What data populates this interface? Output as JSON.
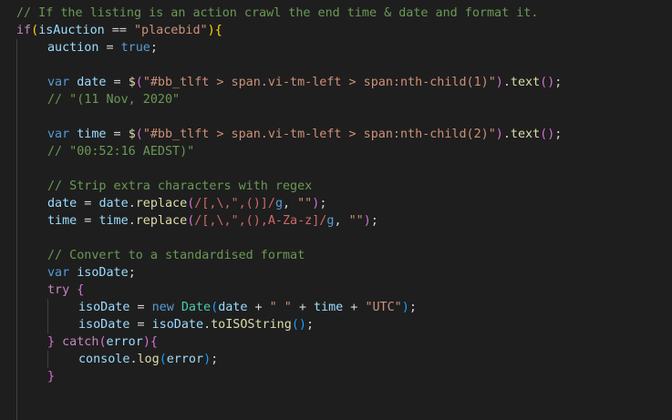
{
  "editor": {
    "lines": [
      {
        "indent": 0,
        "tokens": [
          {
            "t": "// If the listing is an action crawl the end time & date and format it.",
            "c": "c"
          }
        ]
      },
      {
        "indent": 0,
        "tokens": [
          {
            "t": "if",
            "c": "k"
          },
          {
            "t": "(",
            "c": "y"
          },
          {
            "t": "isAuction",
            "c": "v"
          },
          {
            "t": " == ",
            "c": "p"
          },
          {
            "t": "\"placebid\"",
            "c": "s"
          },
          {
            "t": ")",
            "c": "y"
          },
          {
            "t": "{",
            "c": "y"
          }
        ]
      },
      {
        "indent": 1,
        "tokens": [
          {
            "t": "auction",
            "c": "v"
          },
          {
            "t": " = ",
            "c": "p"
          },
          {
            "t": "true",
            "c": "b"
          },
          {
            "t": ";",
            "c": "p"
          }
        ]
      },
      {
        "indent": 1,
        "tokens": []
      },
      {
        "indent": 1,
        "tokens": [
          {
            "t": "var",
            "c": "b"
          },
          {
            "t": " ",
            "c": "p"
          },
          {
            "t": "date",
            "c": "v"
          },
          {
            "t": " = ",
            "c": "p"
          },
          {
            "t": "$",
            "c": "f"
          },
          {
            "t": "(",
            "c": "m"
          },
          {
            "t": "\"#bb_tlft > span.vi-tm-left > span:nth-child(1)\"",
            "c": "s"
          },
          {
            "t": ")",
            "c": "m"
          },
          {
            "t": ".",
            "c": "p"
          },
          {
            "t": "text",
            "c": "f"
          },
          {
            "t": "(",
            "c": "m"
          },
          {
            "t": ")",
            "c": "m"
          },
          {
            "t": ";",
            "c": "p"
          }
        ]
      },
      {
        "indent": 1,
        "tokens": [
          {
            "t": "// \"(11 Nov, 2020\"",
            "c": "c"
          }
        ]
      },
      {
        "indent": 1,
        "tokens": []
      },
      {
        "indent": 1,
        "tokens": [
          {
            "t": "var",
            "c": "b"
          },
          {
            "t": " ",
            "c": "p"
          },
          {
            "t": "time",
            "c": "v"
          },
          {
            "t": " = ",
            "c": "p"
          },
          {
            "t": "$",
            "c": "f"
          },
          {
            "t": "(",
            "c": "m"
          },
          {
            "t": "\"#bb_tlft > span.vi-tm-left > span:nth-child(2)\"",
            "c": "s"
          },
          {
            "t": ")",
            "c": "m"
          },
          {
            "t": ".",
            "c": "p"
          },
          {
            "t": "text",
            "c": "f"
          },
          {
            "t": "(",
            "c": "m"
          },
          {
            "t": ")",
            "c": "m"
          },
          {
            "t": ";",
            "c": "p"
          }
        ]
      },
      {
        "indent": 1,
        "tokens": [
          {
            "t": "// \"00:52:16 AEDST)\"",
            "c": "c"
          }
        ]
      },
      {
        "indent": 1,
        "tokens": []
      },
      {
        "indent": 1,
        "tokens": [
          {
            "t": "// Strip extra characters with regex",
            "c": "c"
          }
        ]
      },
      {
        "indent": 1,
        "tokens": [
          {
            "t": "date",
            "c": "v"
          },
          {
            "t": " = ",
            "c": "p"
          },
          {
            "t": "date",
            "c": "v"
          },
          {
            "t": ".",
            "c": "p"
          },
          {
            "t": "replace",
            "c": "f"
          },
          {
            "t": "(",
            "c": "m"
          },
          {
            "t": "/[,\\,\",()]/",
            "c": "r"
          },
          {
            "t": "g",
            "c": "b"
          },
          {
            "t": ", ",
            "c": "p"
          },
          {
            "t": "\"\"",
            "c": "s"
          },
          {
            "t": ")",
            "c": "m"
          },
          {
            "t": ";",
            "c": "p"
          }
        ]
      },
      {
        "indent": 1,
        "tokens": [
          {
            "t": "time",
            "c": "v"
          },
          {
            "t": " = ",
            "c": "p"
          },
          {
            "t": "time",
            "c": "v"
          },
          {
            "t": ".",
            "c": "p"
          },
          {
            "t": "replace",
            "c": "f"
          },
          {
            "t": "(",
            "c": "m"
          },
          {
            "t": "/[,\\,\",(),A-Za-z]/",
            "c": "r"
          },
          {
            "t": "g",
            "c": "b"
          },
          {
            "t": ", ",
            "c": "p"
          },
          {
            "t": "\"\"",
            "c": "s"
          },
          {
            "t": ")",
            "c": "m"
          },
          {
            "t": ";",
            "c": "p"
          }
        ]
      },
      {
        "indent": 1,
        "tokens": []
      },
      {
        "indent": 1,
        "tokens": [
          {
            "t": "// Convert to a standardised format",
            "c": "c"
          }
        ]
      },
      {
        "indent": 1,
        "tokens": [
          {
            "t": "var",
            "c": "b"
          },
          {
            "t": " ",
            "c": "p"
          },
          {
            "t": "isoDate",
            "c": "v"
          },
          {
            "t": ";",
            "c": "p"
          }
        ]
      },
      {
        "indent": 1,
        "tokens": [
          {
            "t": "try",
            "c": "k"
          },
          {
            "t": " ",
            "c": "p"
          },
          {
            "t": "{",
            "c": "m"
          }
        ]
      },
      {
        "indent": 2,
        "tokens": [
          {
            "t": "isoDate",
            "c": "v"
          },
          {
            "t": " = ",
            "c": "p"
          },
          {
            "t": "new",
            "c": "b"
          },
          {
            "t": " ",
            "c": "p"
          },
          {
            "t": "Date",
            "c": "t"
          },
          {
            "t": "(",
            "c": "u"
          },
          {
            "t": "date",
            "c": "v"
          },
          {
            "t": " + ",
            "c": "p"
          },
          {
            "t": "\" \"",
            "c": "s"
          },
          {
            "t": " + ",
            "c": "p"
          },
          {
            "t": "time",
            "c": "v"
          },
          {
            "t": " + ",
            "c": "p"
          },
          {
            "t": "\"UTC\"",
            "c": "s"
          },
          {
            "t": ")",
            "c": "u"
          },
          {
            "t": ";",
            "c": "p"
          }
        ]
      },
      {
        "indent": 2,
        "tokens": [
          {
            "t": "isoDate",
            "c": "v"
          },
          {
            "t": " = ",
            "c": "p"
          },
          {
            "t": "isoDate",
            "c": "v"
          },
          {
            "t": ".",
            "c": "p"
          },
          {
            "t": "toISOString",
            "c": "f"
          },
          {
            "t": "(",
            "c": "u"
          },
          {
            "t": ")",
            "c": "u"
          },
          {
            "t": ";",
            "c": "p"
          }
        ]
      },
      {
        "indent": 1,
        "tokens": [
          {
            "t": "}",
            "c": "m"
          },
          {
            "t": " ",
            "c": "p"
          },
          {
            "t": "catch",
            "c": "k"
          },
          {
            "t": "(",
            "c": "m"
          },
          {
            "t": "error",
            "c": "v"
          },
          {
            "t": ")",
            "c": "m"
          },
          {
            "t": "{",
            "c": "m"
          }
        ]
      },
      {
        "indent": 2,
        "tokens": [
          {
            "t": "console",
            "c": "v"
          },
          {
            "t": ".",
            "c": "p"
          },
          {
            "t": "log",
            "c": "f"
          },
          {
            "t": "(",
            "c": "u"
          },
          {
            "t": "error",
            "c": "v"
          },
          {
            "t": ")",
            "c": "u"
          },
          {
            "t": ";",
            "c": "p"
          }
        ]
      },
      {
        "indent": 1,
        "tokens": [
          {
            "t": "}",
            "c": "m"
          }
        ]
      }
    ]
  }
}
